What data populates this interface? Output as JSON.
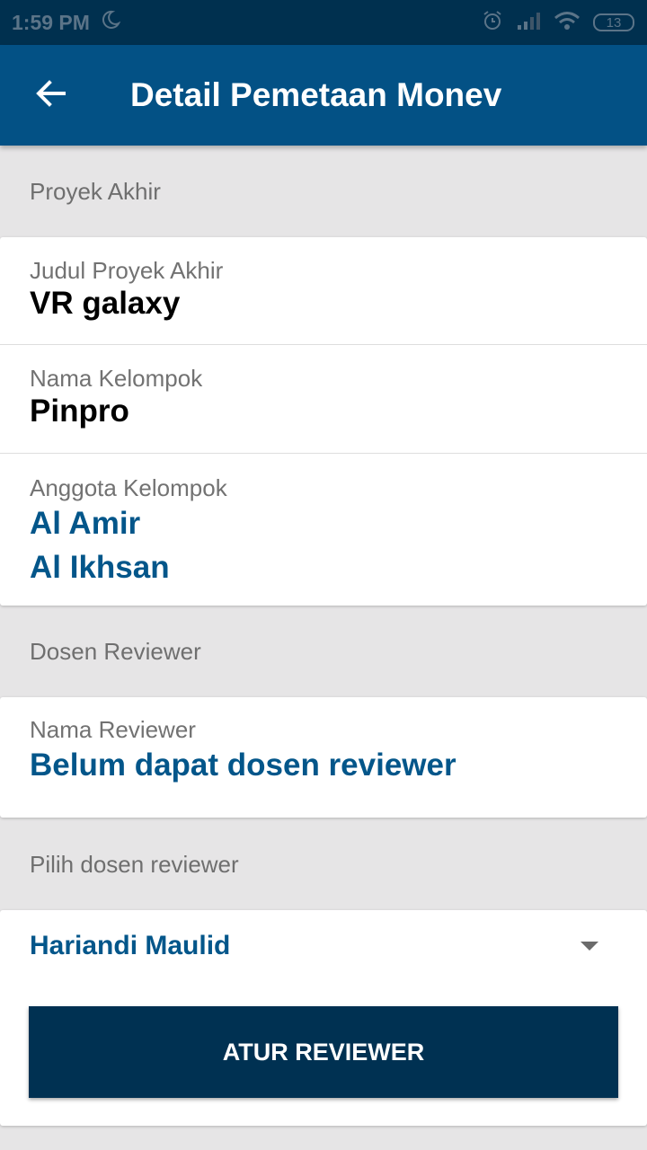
{
  "status_bar": {
    "time": "1:59 PM",
    "battery": "13",
    "icons": [
      "moon-icon",
      "alarm-icon",
      "signal-icon",
      "wifi-icon",
      "battery-icon"
    ]
  },
  "app_bar": {
    "title": "Detail Pemetaan Monev",
    "back_icon": "arrow-back-icon"
  },
  "proyek_section": {
    "title": "Proyek Akhir",
    "judul_label": "Judul Proyek Akhir",
    "judul_value": "VR galaxy",
    "kelompok_label": "Nama Kelompok",
    "kelompok_value": "Pinpro",
    "anggota_label": "Anggota Kelompok",
    "anggota": [
      "Al Amir",
      "Al Ikhsan"
    ]
  },
  "reviewer_section": {
    "title": "Dosen Reviewer",
    "nama_label": "Nama Reviewer",
    "nama_value": "Belum dapat dosen reviewer"
  },
  "pilih_section": {
    "title": "Pilih dosen reviewer",
    "selected": "Hariandi Maulid",
    "button_label": "ATUR REVIEWER"
  },
  "colors": {
    "app_bar": "#035185",
    "status_bar": "#00304f",
    "accent_text": "#03568a",
    "button": "#003152",
    "background": "#e6e5e6"
  }
}
